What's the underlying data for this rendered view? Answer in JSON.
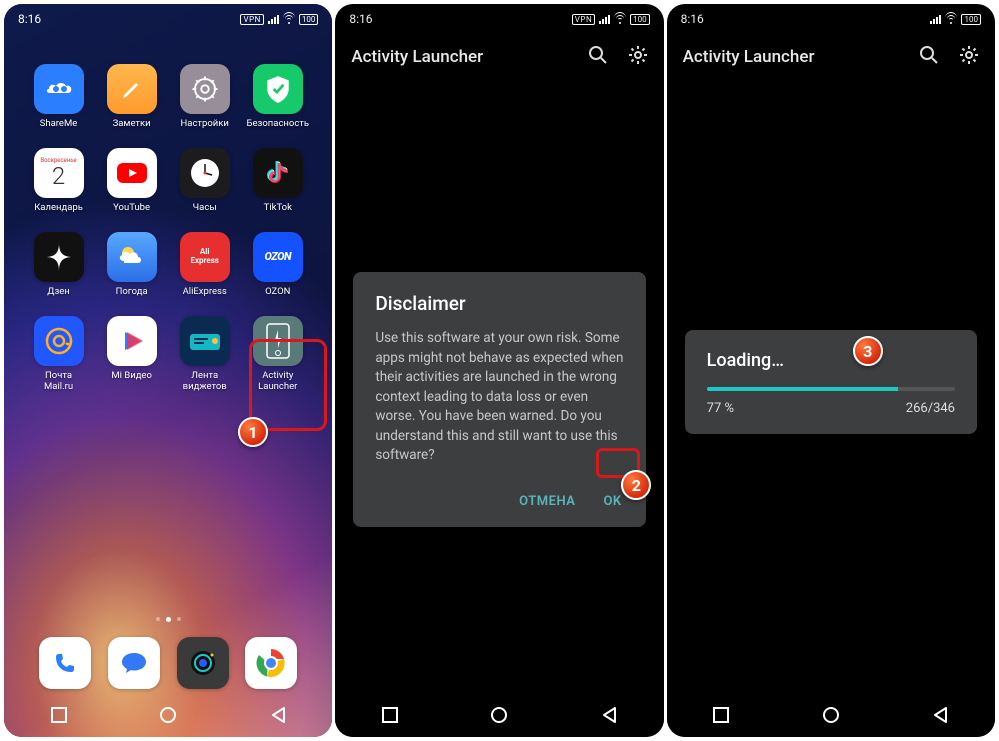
{
  "time": "8:16",
  "battery": "100",
  "vpn_badge": "VPN",
  "apps": {
    "row1": [
      {
        "name": "shareme",
        "label": "ShareMe"
      },
      {
        "name": "notes",
        "label": "Заметки"
      },
      {
        "name": "settings",
        "label": "Настройки"
      },
      {
        "name": "security",
        "label": "Безопасность"
      }
    ],
    "row2": [
      {
        "name": "calendar",
        "label": "Календарь",
        "weekday": "Воскресенье",
        "day": "2"
      },
      {
        "name": "youtube",
        "label": "YouTube"
      },
      {
        "name": "clock",
        "label": "Часы"
      },
      {
        "name": "tiktok",
        "label": "TikTok"
      }
    ],
    "row3": [
      {
        "name": "dzen",
        "label": "Дзен"
      },
      {
        "name": "weather",
        "label": "Погода"
      },
      {
        "name": "aliexpress",
        "label": "AliExpress",
        "text": "AliExpress"
      },
      {
        "name": "ozon",
        "label": "OZON",
        "text": "OZON"
      }
    ],
    "row4": [
      {
        "name": "mailru",
        "label": "Почта\nMail.ru"
      },
      {
        "name": "mivideo",
        "label": "Mi Видео"
      },
      {
        "name": "widgets",
        "label": "Лента\nвиджетов"
      },
      {
        "name": "activity-launcher",
        "label": "Activity\nLauncher"
      }
    ]
  },
  "dock": [
    "phone",
    "messages",
    "camera",
    "chrome"
  ],
  "app_title": "Activity Launcher",
  "dialog": {
    "title": "Disclaimer",
    "body": "Use this software at your own risk. Some apps might not behave as expected when their activities are launched in the wrong context leading to data loss or even worse. You have been warned. Do you understand this and still want to use this software?",
    "cancel": "ОТМЕНА",
    "ok": "OK"
  },
  "loading": {
    "title": "Loading…",
    "percent": "77 %",
    "progress_value": 77,
    "count": "266/346"
  },
  "steps": {
    "s1": "1",
    "s2": "2",
    "s3": "3"
  }
}
